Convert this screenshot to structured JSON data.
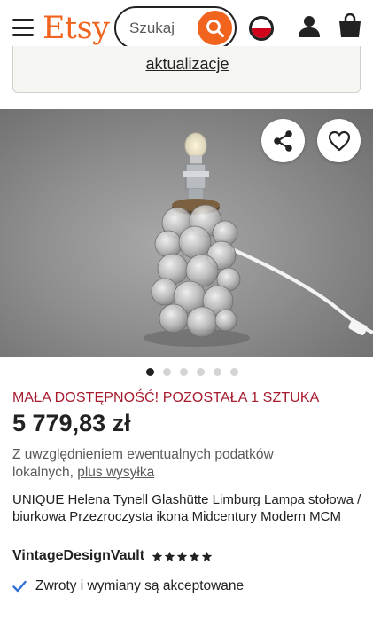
{
  "header": {
    "logo": "Etsy",
    "search_placeholder": "Szukaj",
    "icons": [
      "menu-icon",
      "search-icon",
      "flag-icon",
      "user-icon",
      "bag-icon"
    ]
  },
  "notice": {
    "link_text": "aktualizacje"
  },
  "product": {
    "image_count": 6,
    "active_image": 1,
    "availability": "MAŁA DOSTĘPNOŚĆ! POZOSTAŁA 1 SZTUKA",
    "price": "5 779,83 zł",
    "tax_note": "Z uwzględnieniem ewentualnych podatków lokalnych, ",
    "shipping_link": "plus wysyłka",
    "title": "UNIQUE Helena Tynell Glashütte Limburg Lampa stołowa / biurkowa Przezroczysta ikona Midcentury Modern MCM",
    "shop_name": "VintageDesignVault",
    "rating_stars": 5,
    "returns_text": "Zwroty i wymiany są akceptowane"
  },
  "colors": {
    "brand": "#F1641E",
    "availability": "#A61A2E",
    "check": "#2F6FD6"
  }
}
